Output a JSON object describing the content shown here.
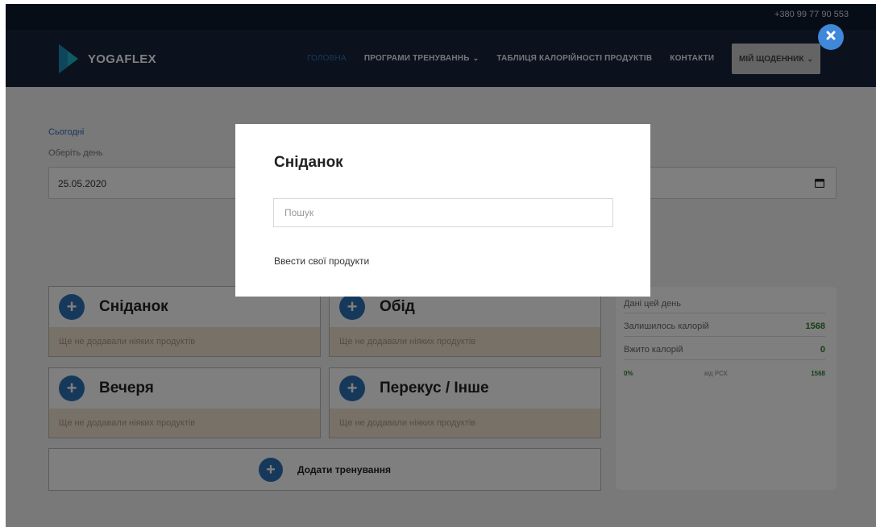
{
  "header": {
    "phone": "+380 99 77 90 553",
    "logo_text": "YOGAFLEX",
    "nav": [
      {
        "label": "ГОЛОВНА",
        "active": true,
        "dropdown": false
      },
      {
        "label": "ПРОГРАМИ ТРЕНУВАННЬ",
        "active": false,
        "dropdown": true
      },
      {
        "label": "ТАБЛИЦЯ КАЛОРІЙНОСТІ ПРОДУКТІВ",
        "active": false,
        "dropdown": false
      },
      {
        "label": "КОНТАКТИ",
        "active": false,
        "dropdown": false
      }
    ],
    "diary_button": "МІЙ ЩОДЕННИК"
  },
  "date_section": {
    "today_link": "Сьогодні",
    "choose_label": "Оберіть день",
    "date_value": "25.05.2020"
  },
  "meals": [
    {
      "title": "Сніданок",
      "empty_text": "Ще не додавали ніяких продуктів"
    },
    {
      "title": "Обід",
      "empty_text": "Ще не додавали ніяких продуктів"
    },
    {
      "title": "Вечеря",
      "empty_text": "Ще не додавали ніяких продуктів"
    },
    {
      "title": "Перекус / Інше",
      "empty_text": "Ще не додавали ніяких продуктів"
    }
  ],
  "training": {
    "label": "Додати тренування"
  },
  "stats": {
    "title": "Дані цей день",
    "remaining_label": "Залишилось калорій",
    "remaining_value": "1568",
    "consumed_label": "Вжито калорій",
    "consumed_value": "0",
    "percent": "0%",
    "of_label": "від РСК",
    "rsk_value": "1568"
  },
  "modal": {
    "title": "Сніданок",
    "search_placeholder": "Пошук",
    "own_products_link": "Ввести свої продукти"
  },
  "icons": {
    "plus": "plus-icon",
    "close": "close-icon",
    "calendar": "calendar-icon",
    "chevron": "chevron-down-icon"
  },
  "colors": {
    "accent": "#2d73b6",
    "nav_bg": "#16223a",
    "top_bg": "#0f1b2d",
    "value_green": "#2e7d2e",
    "empty_bg": "#efe3cf"
  }
}
